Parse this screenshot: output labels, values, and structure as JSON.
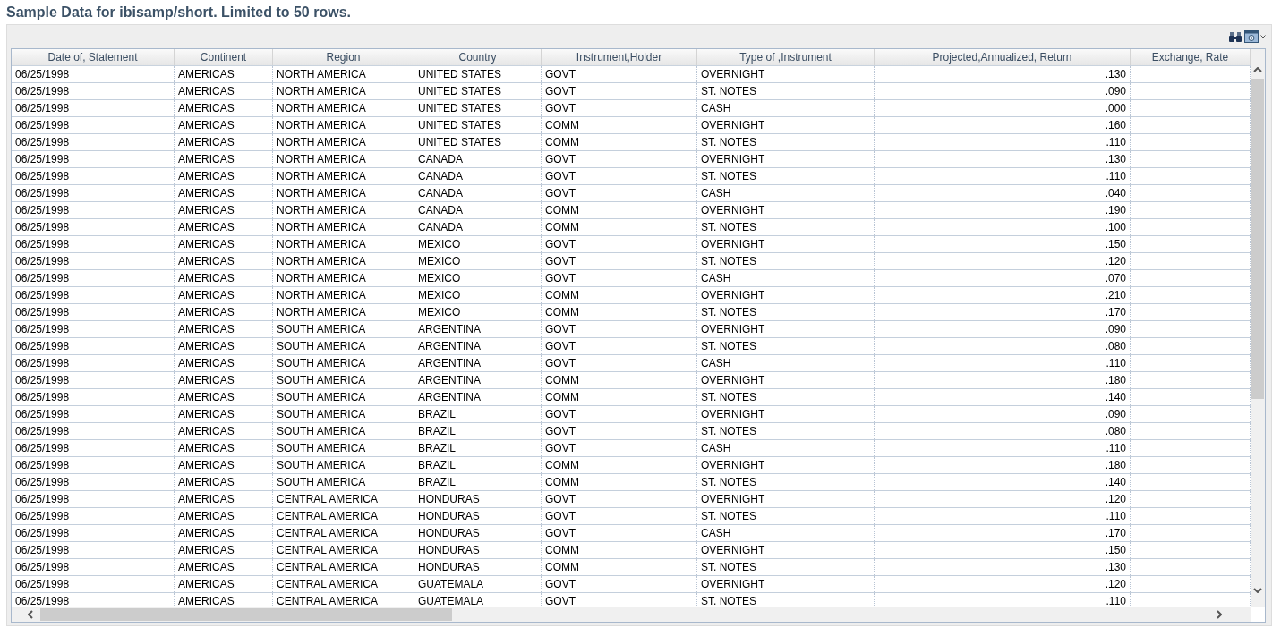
{
  "title": "Sample Data for ibisamp/short. Limited to 50 rows.",
  "table": {
    "columns": [
      "Date of, Statement",
      "Continent",
      "Region",
      "Country",
      "Instrument,Holder",
      "Type of ,Instrument",
      "Projected,Annualized, Return",
      "Exchange, Rate"
    ],
    "rows": [
      [
        "06/25/1998",
        "AMERICAS",
        "NORTH AMERICA",
        "UNITED STATES",
        "GOVT",
        "OVERNIGHT",
        ".130"
      ],
      [
        "06/25/1998",
        "AMERICAS",
        "NORTH AMERICA",
        "UNITED STATES",
        "GOVT",
        "ST. NOTES",
        ".090"
      ],
      [
        "06/25/1998",
        "AMERICAS",
        "NORTH AMERICA",
        "UNITED STATES",
        "GOVT",
        "CASH",
        ".000"
      ],
      [
        "06/25/1998",
        "AMERICAS",
        "NORTH AMERICA",
        "UNITED STATES",
        "COMM",
        "OVERNIGHT",
        ".160"
      ],
      [
        "06/25/1998",
        "AMERICAS",
        "NORTH AMERICA",
        "UNITED STATES",
        "COMM",
        "ST. NOTES",
        ".110"
      ],
      [
        "06/25/1998",
        "AMERICAS",
        "NORTH AMERICA",
        "CANADA",
        "GOVT",
        "OVERNIGHT",
        ".130"
      ],
      [
        "06/25/1998",
        "AMERICAS",
        "NORTH AMERICA",
        "CANADA",
        "GOVT",
        "ST. NOTES",
        ".110"
      ],
      [
        "06/25/1998",
        "AMERICAS",
        "NORTH AMERICA",
        "CANADA",
        "GOVT",
        "CASH",
        ".040"
      ],
      [
        "06/25/1998",
        "AMERICAS",
        "NORTH AMERICA",
        "CANADA",
        "COMM",
        "OVERNIGHT",
        ".190"
      ],
      [
        "06/25/1998",
        "AMERICAS",
        "NORTH AMERICA",
        "CANADA",
        "COMM",
        "ST. NOTES",
        ".100"
      ],
      [
        "06/25/1998",
        "AMERICAS",
        "NORTH AMERICA",
        "MEXICO",
        "GOVT",
        "OVERNIGHT",
        ".150"
      ],
      [
        "06/25/1998",
        "AMERICAS",
        "NORTH AMERICA",
        "MEXICO",
        "GOVT",
        "ST. NOTES",
        ".120"
      ],
      [
        "06/25/1998",
        "AMERICAS",
        "NORTH AMERICA",
        "MEXICO",
        "GOVT",
        "CASH",
        ".070"
      ],
      [
        "06/25/1998",
        "AMERICAS",
        "NORTH AMERICA",
        "MEXICO",
        "COMM",
        "OVERNIGHT",
        ".210"
      ],
      [
        "06/25/1998",
        "AMERICAS",
        "NORTH AMERICA",
        "MEXICO",
        "COMM",
        "ST. NOTES",
        ".170"
      ],
      [
        "06/25/1998",
        "AMERICAS",
        "SOUTH AMERICA",
        "ARGENTINA",
        "GOVT",
        "OVERNIGHT",
        ".090"
      ],
      [
        "06/25/1998",
        "AMERICAS",
        "SOUTH AMERICA",
        "ARGENTINA",
        "GOVT",
        "ST. NOTES",
        ".080"
      ],
      [
        "06/25/1998",
        "AMERICAS",
        "SOUTH AMERICA",
        "ARGENTINA",
        "GOVT",
        "CASH",
        ".110"
      ],
      [
        "06/25/1998",
        "AMERICAS",
        "SOUTH AMERICA",
        "ARGENTINA",
        "COMM",
        "OVERNIGHT",
        ".180"
      ],
      [
        "06/25/1998",
        "AMERICAS",
        "SOUTH AMERICA",
        "ARGENTINA",
        "COMM",
        "ST. NOTES",
        ".140"
      ],
      [
        "06/25/1998",
        "AMERICAS",
        "SOUTH AMERICA",
        "BRAZIL",
        "GOVT",
        "OVERNIGHT",
        ".090"
      ],
      [
        "06/25/1998",
        "AMERICAS",
        "SOUTH AMERICA",
        "BRAZIL",
        "GOVT",
        "ST. NOTES",
        ".080"
      ],
      [
        "06/25/1998",
        "AMERICAS",
        "SOUTH AMERICA",
        "BRAZIL",
        "GOVT",
        "CASH",
        ".110"
      ],
      [
        "06/25/1998",
        "AMERICAS",
        "SOUTH AMERICA",
        "BRAZIL",
        "COMM",
        "OVERNIGHT",
        ".180"
      ],
      [
        "06/25/1998",
        "AMERICAS",
        "SOUTH AMERICA",
        "BRAZIL",
        "COMM",
        "ST. NOTES",
        ".140"
      ],
      [
        "06/25/1998",
        "AMERICAS",
        "CENTRAL AMERICA",
        "HONDURAS",
        "GOVT",
        "OVERNIGHT",
        ".120"
      ],
      [
        "06/25/1998",
        "AMERICAS",
        "CENTRAL AMERICA",
        "HONDURAS",
        "GOVT",
        "ST. NOTES",
        ".110"
      ],
      [
        "06/25/1998",
        "AMERICAS",
        "CENTRAL AMERICA",
        "HONDURAS",
        "GOVT",
        "CASH",
        ".170"
      ],
      [
        "06/25/1998",
        "AMERICAS",
        "CENTRAL AMERICA",
        "HONDURAS",
        "COMM",
        "OVERNIGHT",
        ".150"
      ],
      [
        "06/25/1998",
        "AMERICAS",
        "CENTRAL AMERICA",
        "HONDURAS",
        "COMM",
        "ST. NOTES",
        ".130"
      ],
      [
        "06/25/1998",
        "AMERICAS",
        "CENTRAL AMERICA",
        "GUATEMALA",
        "GOVT",
        "OVERNIGHT",
        ".120"
      ],
      [
        "06/25/1998",
        "AMERICAS",
        "CENTRAL AMERICA",
        "GUATEMALA",
        "GOVT",
        "ST. NOTES",
        ".110"
      ]
    ]
  }
}
